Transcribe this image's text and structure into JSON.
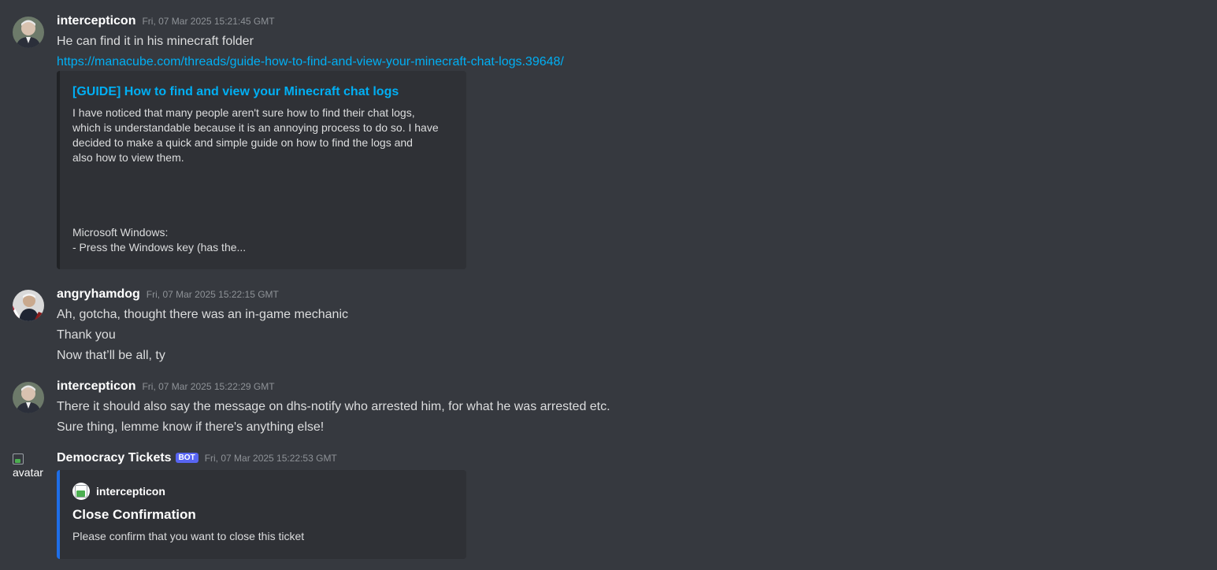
{
  "messages": [
    {
      "username": "intercepticon",
      "timestamp": "Fri, 07 Mar 2025 15:21:45 GMT",
      "lines": [
        "He can find it in his minecraft folder"
      ],
      "link": "https://manacube.com/threads/guide-how-to-find-and-view-your-minecraft-chat-logs.39648/",
      "embed": {
        "title": "[GUIDE] How to find and view your Minecraft chat logs",
        "desc1": "I have noticed that many people aren't sure how to find their chat logs,",
        "desc2": "which is understandable because it is an annoying process to do so. I have",
        "desc3": "decided to make a quick and simple guide on how to find the logs and",
        "desc4": "also how to view them.",
        "desc5": "Microsoft Windows:",
        "desc6": "- Press the Windows key (has the..."
      }
    },
    {
      "username": "angryhamdog",
      "timestamp": "Fri, 07 Mar 2025 15:22:15 GMT",
      "lines": [
        "Ah, gotcha, thought there was an in-game mechanic",
        "Thank you",
        "Now that’ll be all, ty"
      ]
    },
    {
      "username": "intercepticon",
      "timestamp": "Fri, 07 Mar 2025 15:22:29 GMT",
      "lines": [
        "There it should also say the message on dhs-notify who arrested him, for what he was arrested etc.",
        "Sure thing, lemme know if there's anything else!"
      ]
    },
    {
      "username": "Democracy Tickets",
      "badge": "BOT",
      "timestamp": "Fri, 07 Mar 2025 15:22:53 GMT",
      "avatar_alt": "avatar",
      "embed": {
        "author": "intercepticon",
        "title": "Close Confirmation",
        "desc": "Please confirm that you want to close this ticket"
      }
    }
  ],
  "colors": {
    "background": "#36393f",
    "embed_background": "#2f3136",
    "link": "#00aff4",
    "bot_badge": "#5865f2",
    "embed_accent_blue": "#1e6ee8"
  }
}
